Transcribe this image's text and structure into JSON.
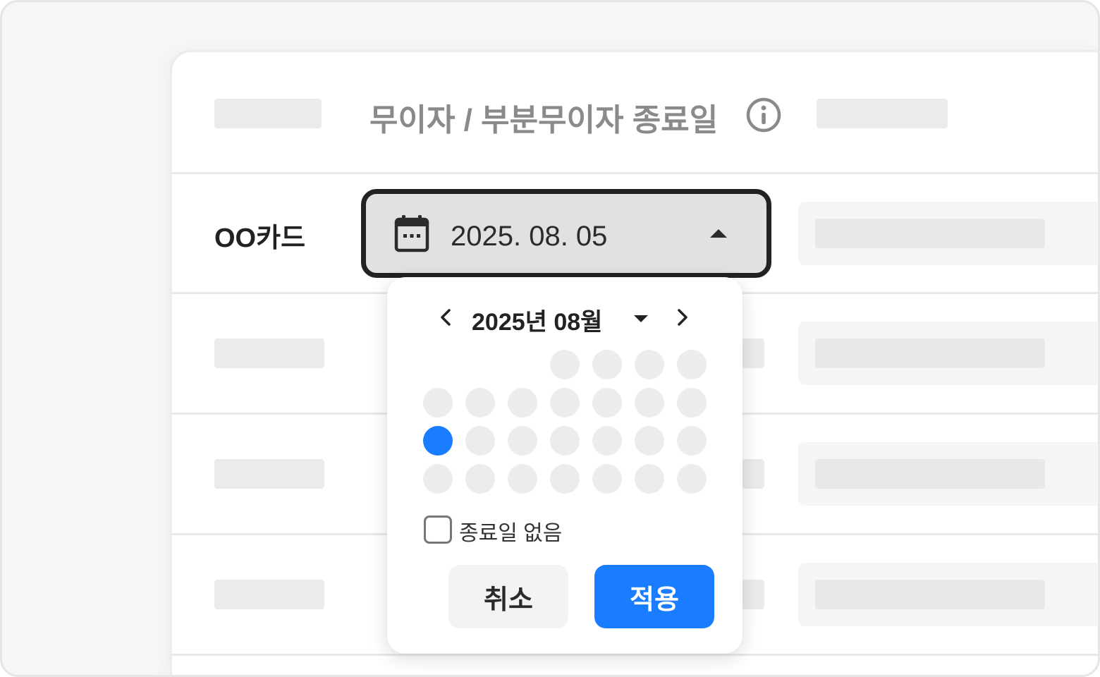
{
  "header": {
    "title": "무이자 / 부분무이자 종료일",
    "info_icon": "info-icon"
  },
  "row": {
    "label": "OO카드"
  },
  "date_field": {
    "value": "2025. 08. 05",
    "calendar_icon": "calendar-icon",
    "caret_icon": "caret-up-icon"
  },
  "calendar": {
    "month_title": "2025년 08월",
    "prev_icon": "chevron-left-icon",
    "next_icon": "chevron-right-icon",
    "month_dropdown_icon": "caret-down-icon",
    "selected_day_index": 11,
    "no_end_date_label": "종료일 없음",
    "no_end_date_checked": false
  },
  "buttons": {
    "cancel": "취소",
    "apply": "적용"
  },
  "colors": {
    "accent": "#1a7cff",
    "placeholder": "#ebebeb",
    "dark": "#222222"
  }
}
